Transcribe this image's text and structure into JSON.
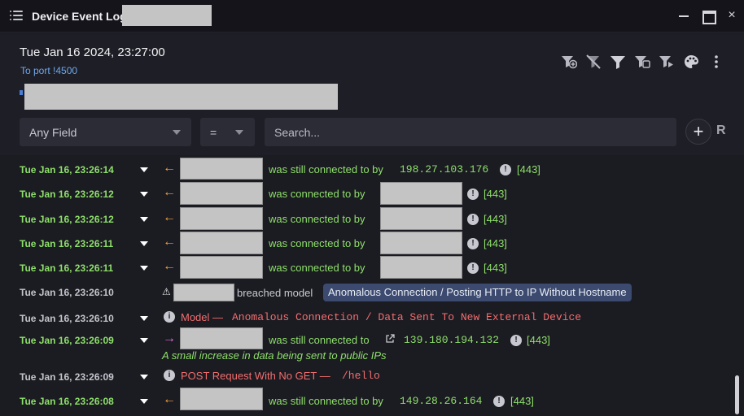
{
  "window": {
    "title": "Device Event Log",
    "controls": {
      "minimize": "minimize-icon",
      "maximize": "maximize-icon",
      "close": "×"
    }
  },
  "header": {
    "date": "Tue Jan 16 2024, 23:27:00",
    "subtitle": "To port !4500",
    "toolbar_icons": [
      "add-filter-icon",
      "clear-filter-icon",
      "filter-icon",
      "filter-settings-icon",
      "filter-device-icon",
      "palette-icon",
      "more-vertical-icon"
    ]
  },
  "filter": {
    "field": "Any Field",
    "operator": "=",
    "search_placeholder": "Search...",
    "add_label": "+",
    "r_label": "R"
  },
  "colors": {
    "accent_green": "#8ee06a",
    "badge_bg": "#3b4a6e",
    "model_red": "#f36e6e",
    "arrow_orange": "#f0a040",
    "arrow_pink": "#e070d8"
  },
  "events": [
    {
      "time": "Tue Jan 16, 23:26:14",
      "text": "was still connected to by",
      "ip": "198.27.103.176",
      "port": "[443]"
    },
    {
      "time": "Tue Jan 16, 23:26:12",
      "text": "was connected to by",
      "port": "[443]"
    },
    {
      "time": "Tue Jan 16, 23:26:12",
      "text": "was connected to by",
      "port": "[443]"
    },
    {
      "time": "Tue Jan 16, 23:26:11",
      "text": "was connected to by",
      "port": "[443]"
    },
    {
      "time": "Tue Jan 16, 23:26:11",
      "text": "was connected to by",
      "port": "[443]"
    },
    {
      "time": "Tue Jan 16, 23:26:10",
      "text": "breached model",
      "badge": "Anomalous Connection / Posting HTTP to IP Without Hostname"
    },
    {
      "time": "Tue Jan 16, 23:26:10",
      "prefix": "Model —",
      "text": "Anomalous Connection / Data Sent To New External Device"
    },
    {
      "time": "Tue Jan 16, 23:26:09",
      "text": "was still connected to",
      "ip": "139.180.194.132",
      "port": "[443]",
      "note": "A small increase in data being sent to public IPs"
    },
    {
      "time": "Tue Jan 16, 23:26:09",
      "prefix": "POST Request With No GET —",
      "text": "/hello"
    },
    {
      "time": "Tue Jan 16, 23:26:08",
      "text": "was still connected to by",
      "ip": "149.28.26.164",
      "port": "[443]"
    }
  ]
}
